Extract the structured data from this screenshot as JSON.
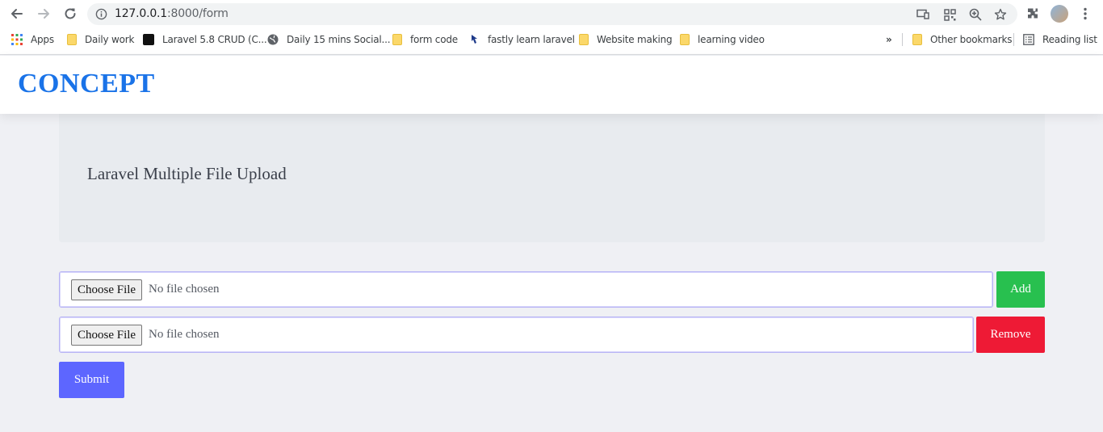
{
  "browser": {
    "url_host": "127.0.0.1",
    "url_path": ":8000/form",
    "bookmarks": [
      {
        "label": "Apps",
        "icon": "apps-grid-icon"
      },
      {
        "label": "Daily work",
        "icon": "folder-icon"
      },
      {
        "label": "Laravel 5.8 CRUD (C...",
        "icon": "site-favicon"
      },
      {
        "label": "Daily 15 mins Social...",
        "icon": "globe-icon"
      },
      {
        "label": "form code",
        "icon": "folder-icon"
      },
      {
        "label": "fastly learn laravel",
        "icon": "pointer-icon"
      },
      {
        "label": "Website making",
        "icon": "folder-icon"
      },
      {
        "label": "learning video",
        "icon": "folder-icon"
      }
    ],
    "overflow_label": "»",
    "other_bookmarks": "Other bookmarks",
    "reading_list": "Reading list"
  },
  "header": {
    "brand": "CONCEPT",
    "brand_color": "#1a73e8"
  },
  "jumbotron": {
    "title": "Laravel Multiple File Upload"
  },
  "form": {
    "rows": [
      {
        "choose_label": "Choose File",
        "status": "No file chosen",
        "action_label": "Add",
        "action_color": "#28c04f"
      },
      {
        "choose_label": "Choose File",
        "status": "No file chosen",
        "action_label": "Remove",
        "action_color": "#ee1a35"
      }
    ],
    "submit_label": "Submit",
    "submit_color": "#5d66ff"
  }
}
